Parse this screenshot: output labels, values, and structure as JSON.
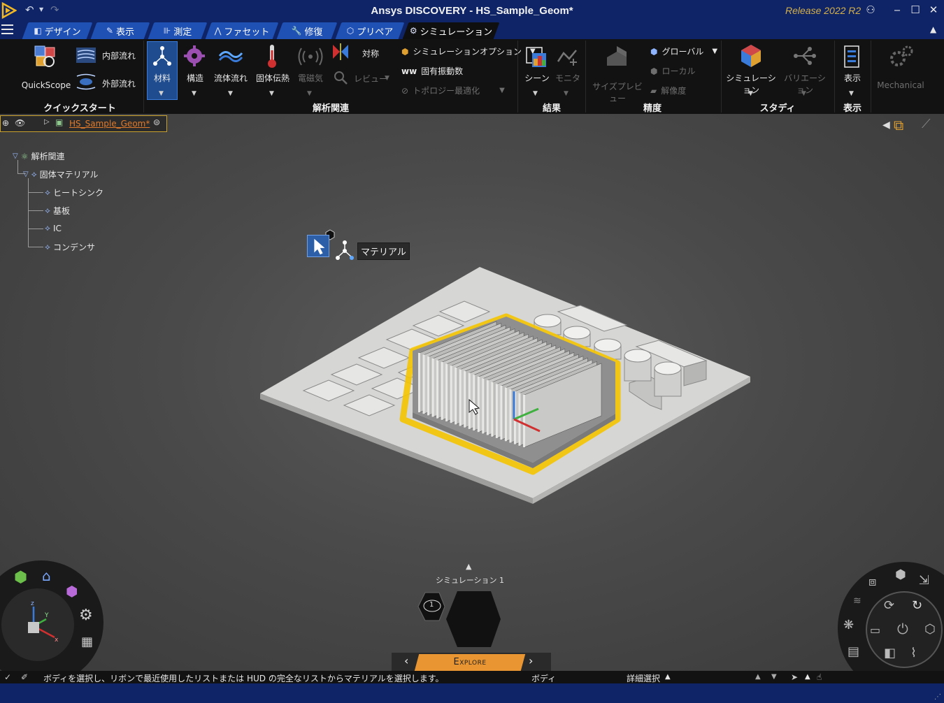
{
  "titlebar": {
    "title": "Ansys DISCOVERY - HS_Sample_Geom*",
    "release": "Release 2022 R2"
  },
  "tabs": [
    {
      "label": "デザイン",
      "icon": "design-icon"
    },
    {
      "label": "表示",
      "icon": "display-icon"
    },
    {
      "label": "測定",
      "icon": "measure-icon"
    },
    {
      "label": "ファセット",
      "icon": "facet-icon"
    },
    {
      "label": "修復",
      "icon": "repair-icon"
    },
    {
      "label": "プリペア",
      "icon": "prepare-icon"
    },
    {
      "label": "シミュレーション",
      "icon": "simulation-icon",
      "active": true
    }
  ],
  "ribbon": {
    "quickstart": {
      "group_label": "クイックスタート",
      "quickscope": "QuickScope",
      "internal_flow": "内部流れ",
      "external_flow": "外部流れ"
    },
    "analysis": {
      "group_label": "解析関連",
      "material": "材料",
      "structure": "構造",
      "fluid_flow": "流体流れ",
      "solid_heat": "固体伝熱",
      "electromagnetic": "電磁気",
      "symmetry": "対称",
      "review": "レビュー",
      "sim_options": "シミュレーションオプション",
      "modal": "固有振動数",
      "topology": "トポロジー最適化"
    },
    "results": {
      "group_label": "結果",
      "scene": "シーン",
      "monitor": "モニタ"
    },
    "fidelity": {
      "group_label": "精度",
      "size_preview": "サイズプレビュー",
      "global": "グローバル",
      "local": "ローカル",
      "resolution": "解像度"
    },
    "study": {
      "group_label": "スタディ",
      "simulation": "シミュレーション",
      "variation": "バリエーション"
    },
    "display": {
      "group_label": "表示",
      "display": "表示"
    },
    "mechanical": "Mechanical"
  },
  "breadcrumb": {
    "name": "HS_Sample_Geom*"
  },
  "tree": {
    "root": "解析関連",
    "solid_material": "固体マテリアル",
    "items": [
      "ヒートシンク",
      "基板",
      "IC",
      "コンデンサ"
    ]
  },
  "hud": {
    "label": "マテリアル"
  },
  "bottom": {
    "simulation_name": "シミュレーション 1",
    "sim_badge": "1",
    "explore": "Explore"
  },
  "status": {
    "message": "ボディを選択し、リボンで最近使用したリストまたは HUD の完全なリストからマテリアルを選択します。",
    "selection_type": "ボディ",
    "detail_select": "詳細選択"
  },
  "colors": {
    "titlebar": "#0e2466",
    "tab": "#1f50b4",
    "ribbon": "#121212",
    "highlight": "#f5c400",
    "explore": "#e89532",
    "tree_name": "#e07a2a"
  }
}
